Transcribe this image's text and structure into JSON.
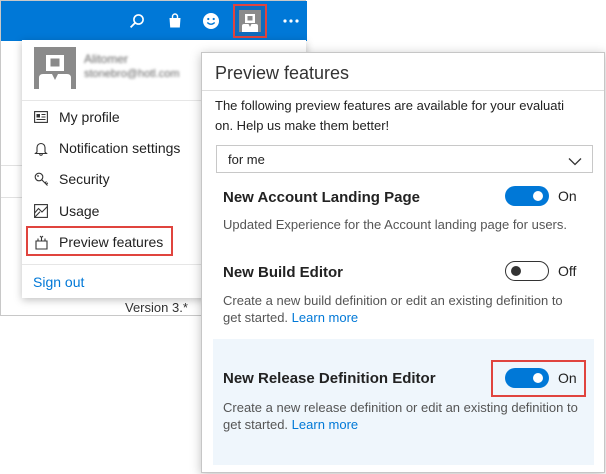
{
  "topbar": {
    "icons": [
      "search-icon",
      "shopping-bag-icon",
      "smiley-icon",
      "user-avatar-icon",
      "more-icon"
    ]
  },
  "profile_menu": {
    "name": "Alitomer",
    "email": "stonebro@hotl.com",
    "items": [
      {
        "label": "My profile",
        "icon": "profile-card-icon"
      },
      {
        "label": "Notification settings",
        "icon": "bell-icon"
      },
      {
        "label": "Security",
        "icon": "key-icon"
      },
      {
        "label": "Usage",
        "icon": "usage-icon"
      },
      {
        "label": "Preview features",
        "icon": "preview-icon"
      }
    ],
    "sign_out": "Sign out"
  },
  "background": {
    "version": "Version  3.*"
  },
  "panel": {
    "title": "Preview features",
    "description_line1": "The following preview features are available for your evaluati",
    "description_line2": "on. Help us make them better!",
    "select_value": "for me",
    "features": [
      {
        "name": "New Account Landing Page",
        "description": "Updated Experience for the Account landing page for users.",
        "enabled": true,
        "state_label": "On"
      },
      {
        "name": "New Build Editor",
        "description": "Create a new build definition or edit an existing definition to get started.",
        "link": "Learn more",
        "enabled": false,
        "state_label": "Off"
      },
      {
        "name": "New Release Definition Editor",
        "description": "Create a new release definition or edit an existing definition to get started.",
        "link": "Learn more",
        "enabled": true,
        "state_label": "On"
      }
    ]
  },
  "colors": {
    "accent": "#0078d7",
    "highlight": "#e0443e",
    "selected_row": "#eff6fc"
  }
}
